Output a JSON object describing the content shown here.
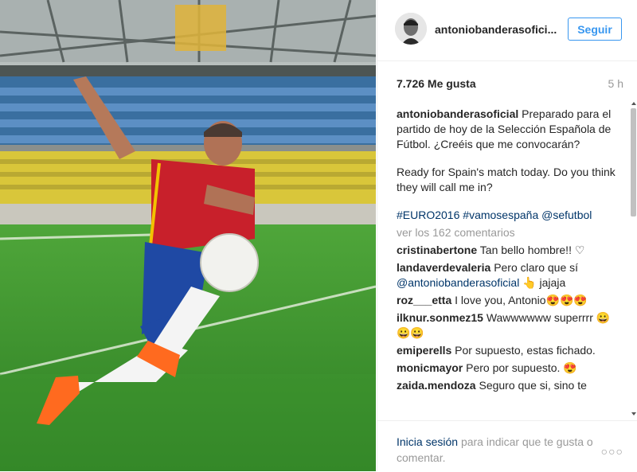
{
  "post": {
    "username": "antoniobanderasofici...",
    "follow_label": "Seguir",
    "likes": "7.726 Me gusta",
    "time": "5 h",
    "caption_user": "antoniobanderasoficial",
    "caption_text": "Preparado para el partido de hoy de la Selección Española de Fútbol. ¿Creéis que me convocarán?",
    "caption_en": "Ready for Spain's match today. Do you think they will call me in?",
    "hashtags": [
      "#EURO2016",
      "#vamosespaña",
      "@sefutbol"
    ],
    "view_comments": "ver los 162 comentarios"
  },
  "comments": [
    {
      "user": "cristinabertone",
      "text": "Tan bello hombre!! ♡"
    },
    {
      "user": "landaverdevaleria",
      "text": "Pero claro que sí",
      "mention": "@antoniobanderasoficial",
      "tail": "👆 jajaja"
    },
    {
      "user": "roz___etta",
      "text": "I love you, Antonio😍😍😍"
    },
    {
      "user": "ilknur.sonmez15",
      "text": "Wawwwwww superrrr 😀😀😀"
    },
    {
      "user": "emiperells",
      "text": "Por supuesto, estas fichado."
    },
    {
      "user": "monicmayor",
      "text": "Pero por supuesto. 😍"
    },
    {
      "user": "zaida.mendoza",
      "text": "Seguro que si, sino te"
    }
  ],
  "footer": {
    "login_link": "Inicia sesión",
    "login_text": "para indicar que te gusta o comentar.",
    "more_options": "○○○"
  }
}
